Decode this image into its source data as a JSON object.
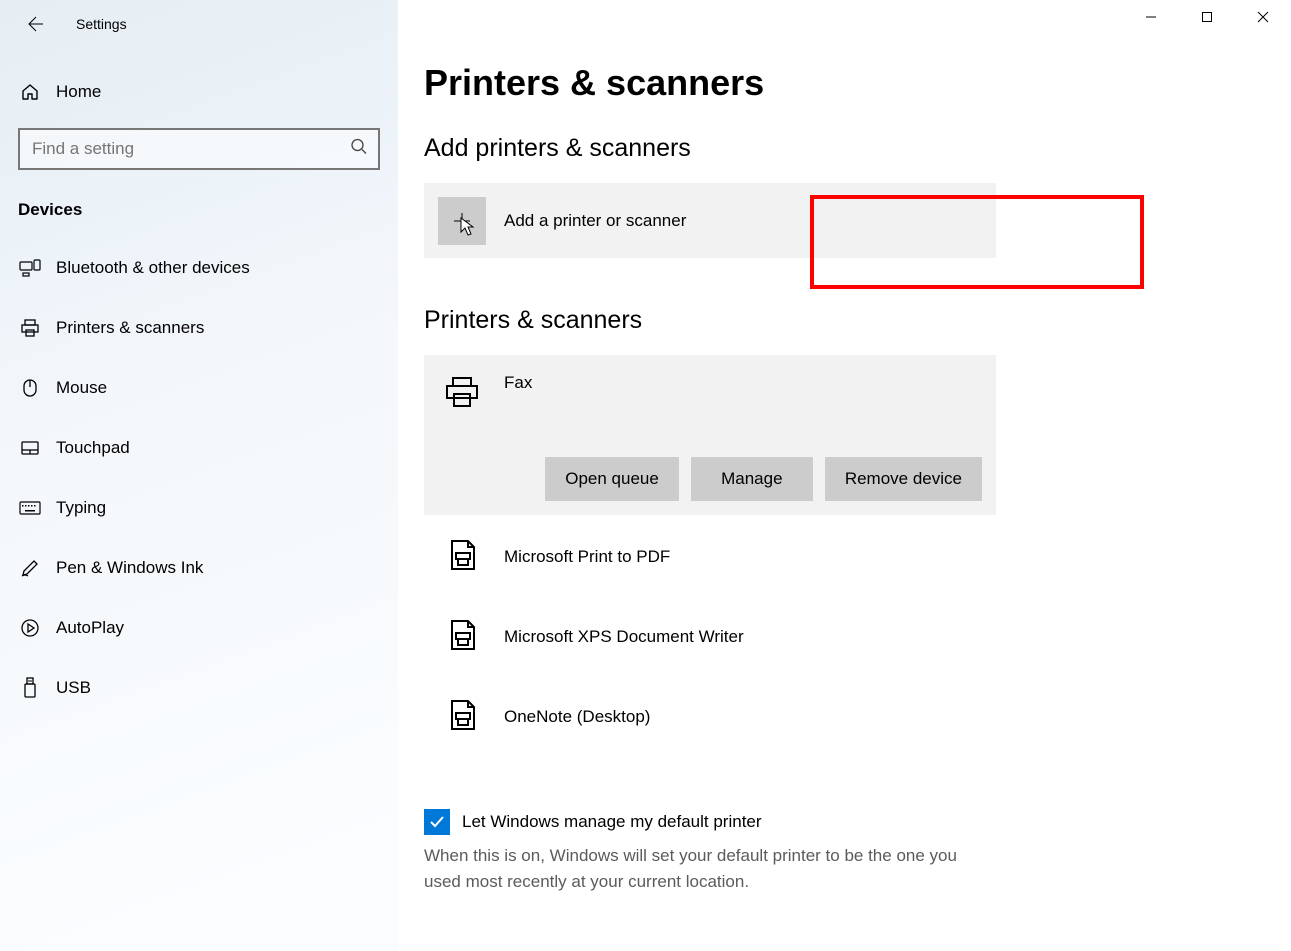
{
  "window": {
    "title": "Settings"
  },
  "sidebar": {
    "home_label": "Home",
    "search_placeholder": "Find a setting",
    "section_header": "Devices",
    "items": [
      {
        "label": "Bluetooth & other devices"
      },
      {
        "label": "Printers & scanners"
      },
      {
        "label": "Mouse"
      },
      {
        "label": "Touchpad"
      },
      {
        "label": "Typing"
      },
      {
        "label": "Pen & Windows Ink"
      },
      {
        "label": "AutoPlay"
      },
      {
        "label": "USB"
      }
    ]
  },
  "main": {
    "page_title": "Printers & scanners",
    "add_section_title": "Add printers & scanners",
    "add_button_label": "Add a printer or scanner",
    "list_section_title": "Printers & scanners",
    "devices": [
      {
        "name": "Fax"
      },
      {
        "name": "Microsoft Print to PDF"
      },
      {
        "name": "Microsoft XPS Document Writer"
      },
      {
        "name": "OneNote (Desktop)"
      }
    ],
    "device_buttons": {
      "open_queue": "Open queue",
      "manage": "Manage",
      "remove": "Remove device"
    },
    "default_printer": {
      "checkbox_label": "Let Windows manage my default printer",
      "help_text": "When this is on, Windows will set your default printer to be the one you used most recently at your current location."
    }
  }
}
